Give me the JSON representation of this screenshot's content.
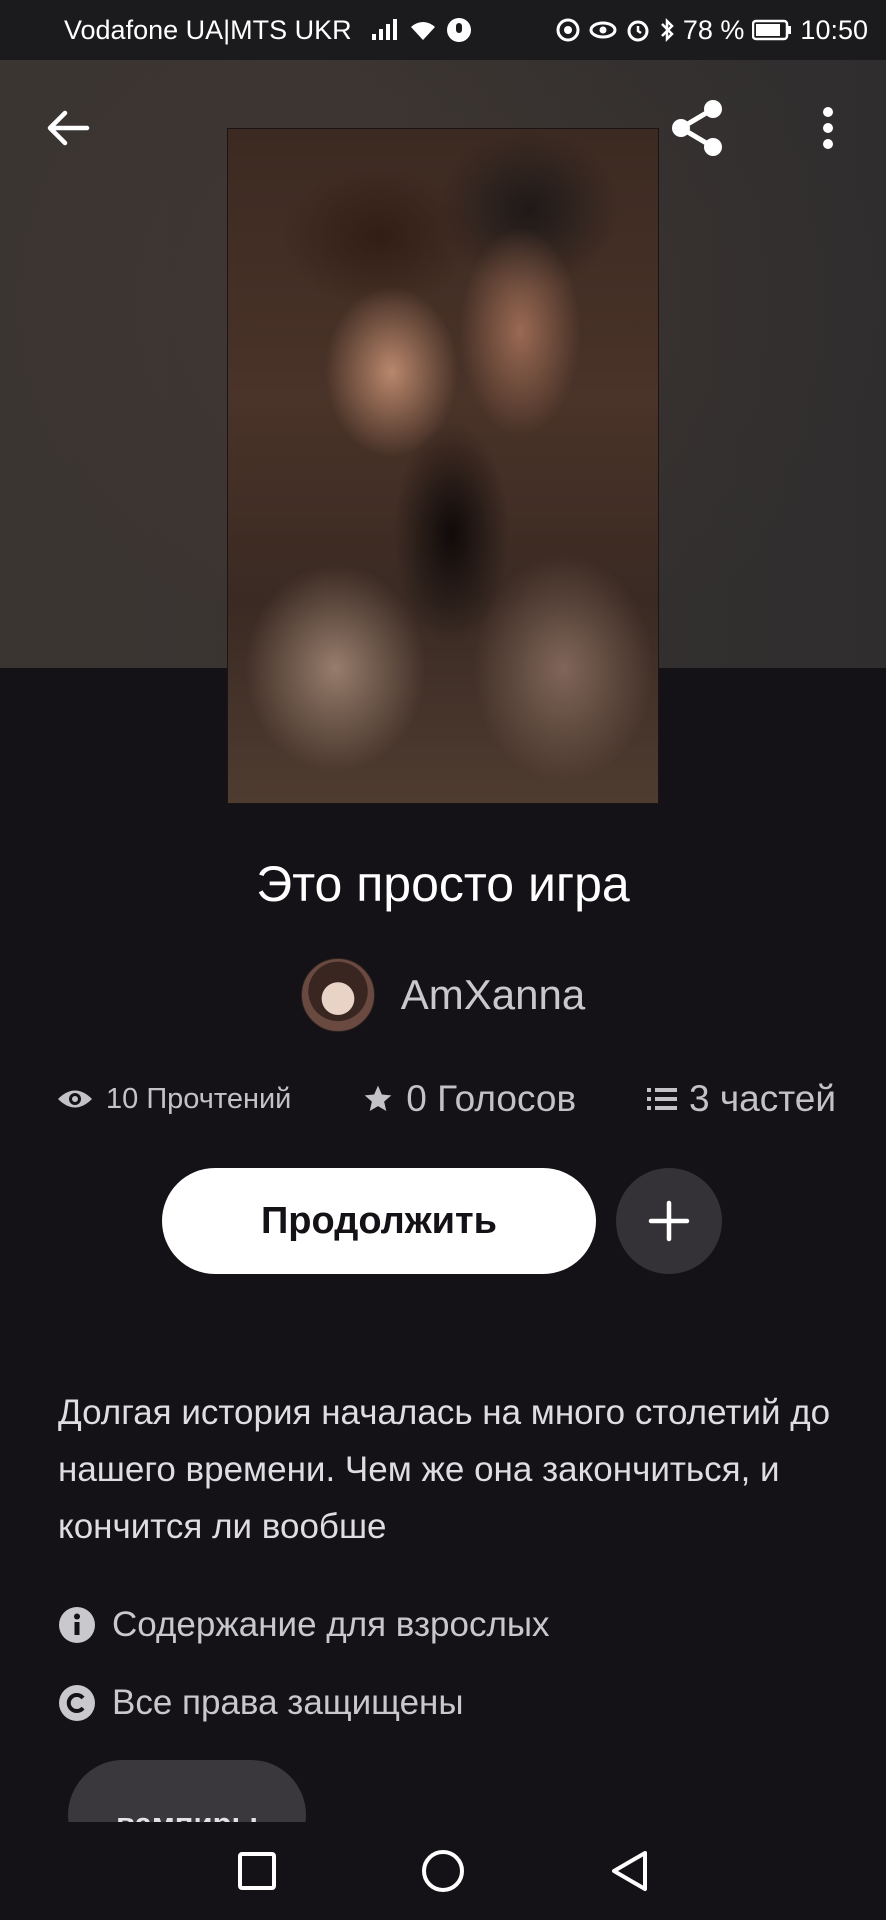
{
  "status_bar": {
    "carrier": "Vodafone UA|MTS UKR",
    "battery": "78 %",
    "time": "10:50"
  },
  "toolbar": {
    "back_icon": "arrow-left-icon",
    "share_icon": "share-icon",
    "more_icon": "more-vertical-icon"
  },
  "story": {
    "title": "Это просто игра",
    "author": "AmXanna",
    "stats": {
      "reads": "10 Прочтений",
      "votes": "0 Голосов",
      "parts": "3 частей"
    },
    "continue_label": "Продолжить",
    "description": "Долгая история началась на много столетий до нашего времени. Чем же она закончиться, и кончится ли вообше",
    "mature": "Содержание для взрослых",
    "copyright": "Все права защищены",
    "tags": [
      "вампиры"
    ]
  },
  "colors": {
    "background": "#141216",
    "button_primary": "#ffffff",
    "button_secondary": "#343236",
    "muted_text": "#c3c2c6"
  }
}
